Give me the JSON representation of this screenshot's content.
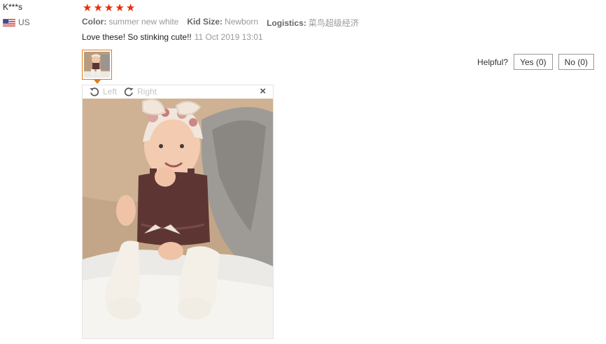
{
  "review": {
    "username": "K***s",
    "country": "US",
    "rating": 5,
    "stars": [
      "★",
      "★",
      "★",
      "★",
      "★"
    ],
    "star_color": "#e62e04",
    "attributes": [
      {
        "key": "Color:",
        "value": "summer new white"
      },
      {
        "key": "Kid Size:",
        "value": "Newborn"
      },
      {
        "key": "Logistics:",
        "value": "菜鸟超级经济"
      }
    ],
    "comment": "Love these! So stinking cute!!",
    "timestamp": "11 Oct 2019 13:01",
    "thumbnail_accent": "#e07b1a"
  },
  "helpful": {
    "label": "Helpful?",
    "yes_label": "Yes (0)",
    "no_label": "No (0)"
  },
  "viewer": {
    "rotate_left_label": "Left",
    "rotate_right_label": "Right",
    "close_glyph": "×",
    "icons": [
      "rotate-left-icon",
      "rotate-right-icon",
      "close-icon"
    ]
  }
}
